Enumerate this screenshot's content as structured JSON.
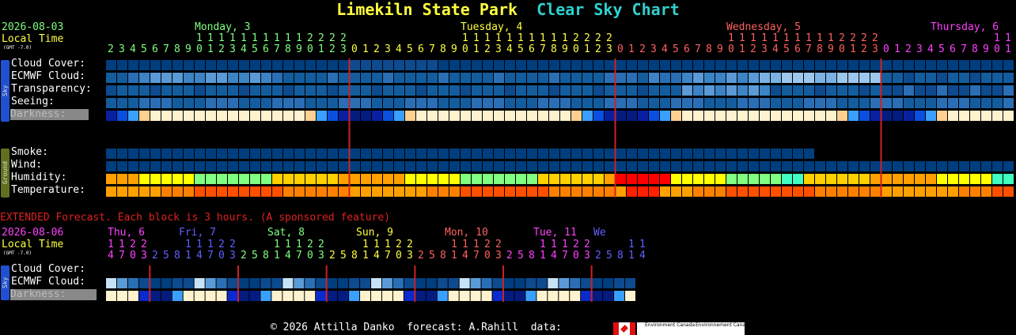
{
  "title": {
    "site": "Limekiln State Park",
    "chart": "Clear Sky Chart"
  },
  "main": {
    "date": "2026-08-03",
    "local_time": "Local Time",
    "gmt": "(GMT -7.0)",
    "days": [
      {
        "label": "Monday, 3",
        "color": "#80ff80"
      },
      {
        "label": "Tuesday, 4",
        "color": "#ffff40"
      },
      {
        "label": "Wednesday, 5",
        "color": "#ff6060"
      },
      {
        "label": "Thursday, 6",
        "color": "#ff40ff"
      }
    ],
    "hours": [
      2,
      3,
      4,
      5,
      6,
      7,
      8,
      9,
      10,
      11,
      12,
      13,
      14,
      15,
      16,
      17,
      18,
      19,
      20,
      21,
      22,
      23,
      0,
      1,
      2,
      3,
      4,
      5,
      6,
      7,
      8,
      9,
      10,
      11,
      12,
      13,
      14,
      15,
      16,
      17,
      18,
      19,
      20,
      21,
      22,
      23,
      0,
      1,
      2,
      3,
      4,
      5,
      6,
      7,
      8,
      9,
      10,
      11,
      12,
      13,
      14,
      15,
      16,
      17,
      18,
      19,
      20,
      21,
      22,
      23,
      0,
      1,
      2,
      3,
      4,
      5,
      6,
      7,
      8,
      9,
      10,
      11
    ],
    "sky_rows": [
      "Cloud Cover:",
      "ECMWF Cloud:",
      "Transparency:",
      "Seeing:",
      "Darkness:"
    ],
    "ground_rows": [
      "Smoke:",
      "Wind:",
      "Humidity:",
      "Temperature:"
    ],
    "sky_label": "Sky",
    "ground_label": "Ground"
  },
  "extended": {
    "note": "EXTENDED Forecast. Each block is 3 hours. (A sponsored feature)",
    "date": "2026-08-06",
    "local_time": "Local Time",
    "gmt": "(GMT -7.0)",
    "days": [
      {
        "label": "Thu, 6",
        "color": "#ff40ff"
      },
      {
        "label": "Fri, 7",
        "color": "#6060ff"
      },
      {
        "label": "Sat, 8",
        "color": "#80ff80"
      },
      {
        "label": "Sun, 9",
        "color": "#ffff40"
      },
      {
        "label": "Mon, 10",
        "color": "#ff6060"
      },
      {
        "label": "Tue, 11",
        "color": "#ff40ff"
      },
      {
        "label": "We",
        "color": "#6060ff"
      }
    ],
    "hours": [
      14,
      17,
      20,
      23,
      2,
      5,
      8,
      11,
      14,
      17,
      20,
      23,
      2,
      5,
      8,
      11,
      14,
      17,
      20,
      23,
      2,
      5,
      8,
      11,
      14,
      17,
      20,
      23,
      2,
      5,
      8,
      11,
      14,
      17,
      20,
      23,
      2,
      5,
      8,
      11,
      14,
      17,
      20,
      23,
      2,
      5,
      8,
      11,
      14
    ],
    "rows": [
      "Cloud Cover:",
      "ECMWF Cloud:",
      "Darkness:"
    ],
    "sky_label": "Sky"
  },
  "footer": {
    "credit": "© 2026 Attilla Danko  forecast: A.Rahill  data:",
    "logo1": "Environment Canada",
    "logo2": "Environnement Canada"
  },
  "colors": {
    "midnight_line": "#d02020",
    "deep_blue": "#003e7e",
    "clear": "#003e7e"
  }
}
